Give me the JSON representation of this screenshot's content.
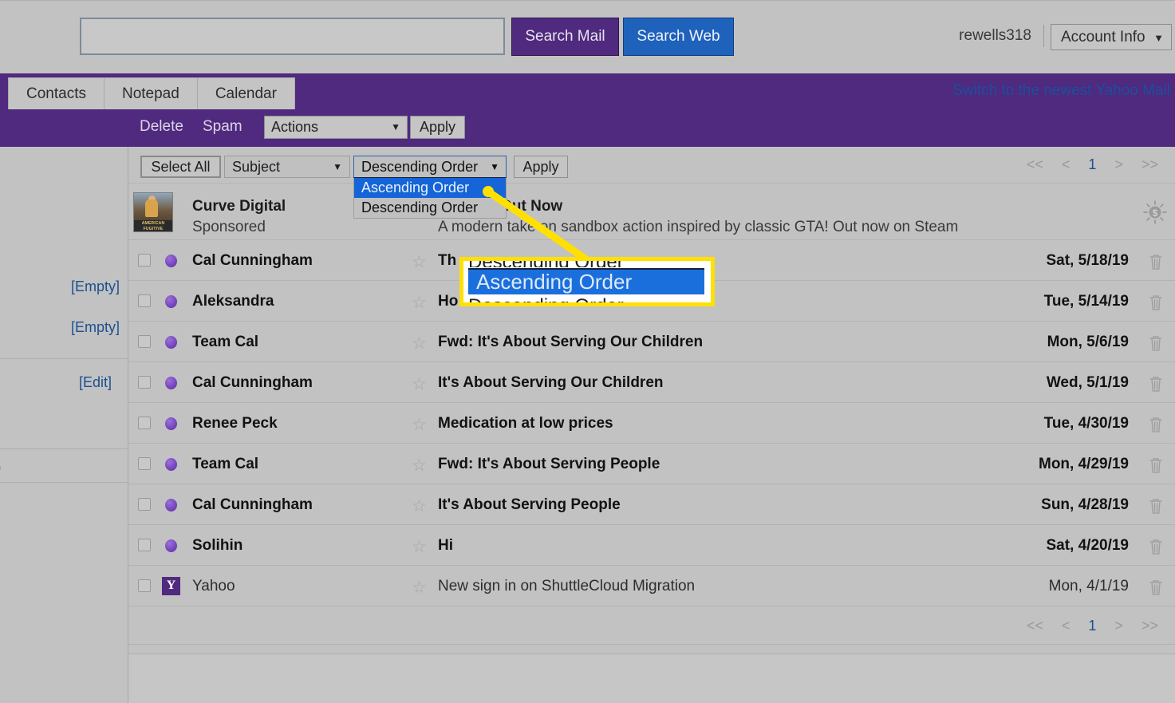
{
  "topbar": {
    "search_placeholder": "",
    "search_value": "",
    "search_mail_label": "Search Mail",
    "search_web_label": "Search Web",
    "username": "rewells318",
    "account_info_label": "Account Info",
    "caret": "▼"
  },
  "tabstrip": {
    "tabs": [
      {
        "label": "Contacts"
      },
      {
        "label": "Notepad"
      },
      {
        "label": "Calendar"
      }
    ],
    "switch_link": "Switch to the newest Yahoo Mail"
  },
  "actionbar": {
    "delete_label": "Delete",
    "spam_label": "Spam",
    "actions_label": "Actions",
    "apply_label": "Apply",
    "caret": "▼"
  },
  "sidebar": {
    "empty_link_1": "[Empty]",
    "empty_link_2": "[Empty]",
    "edit_link": "[Edit]",
    "partial_count": ")"
  },
  "listbar": {
    "select_all_label": "Select All",
    "sort_field_label": "Subject",
    "sort_order_label": "Descending Order",
    "apply_label": "Apply",
    "caret": "▼",
    "dropdown_options": [
      {
        "label": "Ascending Order",
        "selected": true
      },
      {
        "label": "Descending Order",
        "selected": false
      }
    ]
  },
  "pagination": {
    "first": "<<",
    "prev": "<",
    "current": "1",
    "next": ">",
    "last": ">>"
  },
  "ad": {
    "sender": "Curve Digital",
    "sponsored_label": "Sponsored",
    "subject": "Fugitive Out Now",
    "snippet": "A modern take on sandbox action inspired by classic GTA! Out now on Steam",
    "thumb_label": "AMERICAN FUGITIVE",
    "ad_icon_name": "sponsored-dollar-icon"
  },
  "mail_rows": [
    {
      "sender": "Cal Cunningham",
      "subject": "Th",
      "date": "Sat, 5/18/19",
      "read": false,
      "icon": "unread-dot"
    },
    {
      "sender": "Aleksandra",
      "subject": "Ho",
      "date": "Tue, 5/14/19",
      "read": false,
      "icon": "unread-dot"
    },
    {
      "sender": "Team Cal",
      "subject": "Fwd: It's About Serving Our Children",
      "date": "Mon, 5/6/19",
      "read": false,
      "icon": "unread-dot"
    },
    {
      "sender": "Cal Cunningham",
      "subject": "It's About Serving Our Children",
      "date": "Wed, 5/1/19",
      "read": false,
      "icon": "unread-dot"
    },
    {
      "sender": "Renee Peck",
      "subject": "Medication at low prices",
      "date": "Tue, 4/30/19",
      "read": false,
      "icon": "unread-dot"
    },
    {
      "sender": "Team Cal",
      "subject": "Fwd: It's About Serving People",
      "date": "Mon, 4/29/19",
      "read": false,
      "icon": "unread-dot"
    },
    {
      "sender": "Cal Cunningham",
      "subject": "It's About Serving People",
      "date": "Sun, 4/28/19",
      "read": false,
      "icon": "unread-dot"
    },
    {
      "sender": "Solihin",
      "subject": "Hi",
      "date": "Sat, 4/20/19",
      "read": false,
      "icon": "unread-dot"
    },
    {
      "sender": "Yahoo",
      "subject": "New sign in on ShuttleCloud Migration",
      "date": "Mon, 4/1/19",
      "read": true,
      "icon": "yahoo-logo"
    }
  ],
  "callout": {
    "top_text": "Descending Order",
    "selected_text": "Ascending Order",
    "bottom_text": "Descending Order"
  },
  "colors": {
    "purple": "#4f2a7f",
    "blue": "#1f62bb",
    "highlight_blue": "#1565d8",
    "callout_yellow": "#ffe000",
    "link_blue": "#1b4f8f",
    "page_bg": "#c2c2c2"
  }
}
